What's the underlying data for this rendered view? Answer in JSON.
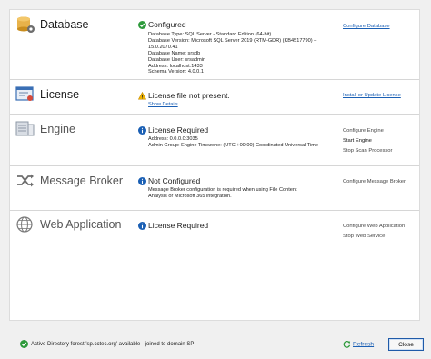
{
  "sections": {
    "database": {
      "title": "Database",
      "status": "Configured",
      "details": [
        "Database Type: SQL Server - Standard Edition (64-bit)",
        "Database Version: Microsoft SQL Server 2019 (RTM-GDR) (KB4517790) –",
        "15.0.2070.41",
        "Database Name: srsdb",
        "Database User: srsadmin",
        "Address: localhost:1433",
        "Schema Version: 4.0.0.1"
      ],
      "actions": [
        "Configure Database"
      ]
    },
    "license": {
      "title": "License",
      "status": "License file not present.",
      "link": "Show Details",
      "actions": [
        "Install or Update License"
      ]
    },
    "engine": {
      "title": "Engine",
      "status": "License Required",
      "details": [
        "Address: 0.0.0.0:3035",
        "Admin Group:  Engine Timezone: (UTC +00:00)  Coordinated Universal Time"
      ],
      "actions": [
        "Configure Engine",
        "Start Engine",
        "Stop Scan Processor"
      ]
    },
    "message_broker": {
      "title": "Message Broker",
      "status": "Not Configured",
      "details": [
        "Message Broker configuration is required when using File Content",
        "Analysis or Microsoft 365 integration."
      ],
      "actions": [
        "Configure Message Broker"
      ]
    },
    "web_application": {
      "title": "Web Application",
      "status": "License Required",
      "actions": [
        "Configure Web Application",
        "Stop Web Service"
      ]
    }
  },
  "footer": {
    "status_text": "Active Directory forest 'sp.cctec.org' available - joined to domain SP",
    "refresh_label": "Refresh",
    "close_label": "Close"
  },
  "colors": {
    "ok": "#2e9a3c",
    "warning": "#e6a400",
    "info": "#1a5fb4",
    "link": "#1a5fb4"
  }
}
